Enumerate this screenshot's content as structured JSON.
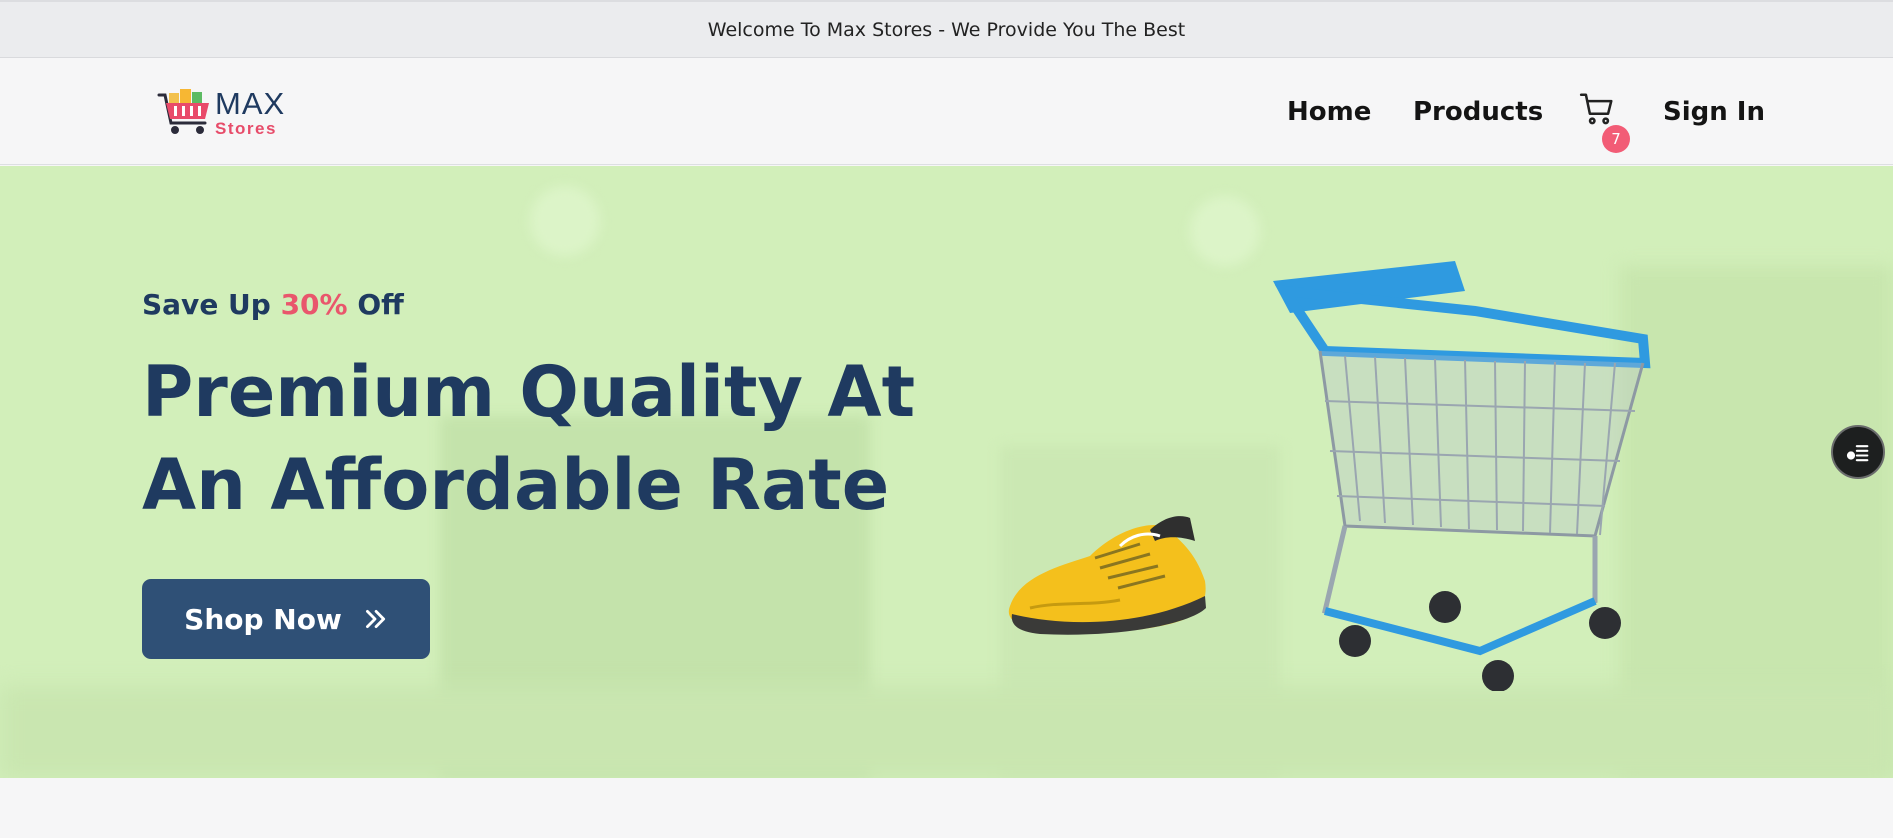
{
  "announcement": "Welcome To Max Stores - We Provide You The Best",
  "logo": {
    "brand": "MAX",
    "tagline": "Stores"
  },
  "nav": {
    "home": "Home",
    "products": "Products",
    "cart_count": "7",
    "sign_in": "Sign In"
  },
  "hero": {
    "subtitle_pre": "Save Up ",
    "subtitle_pct": "30%",
    "subtitle_post": " Off",
    "title": "Premium Quality At An Affordable Rate",
    "cta_label": "Shop Now"
  },
  "colors": {
    "primary": "#1f3a60",
    "accent": "#e9566c",
    "hero_bg": "#d2efba",
    "button": "#2f5076"
  },
  "icons": [
    "cart-icon",
    "double-chevron-right-icon",
    "list-menu-icon",
    "shopping-cart-logo-icon"
  ]
}
